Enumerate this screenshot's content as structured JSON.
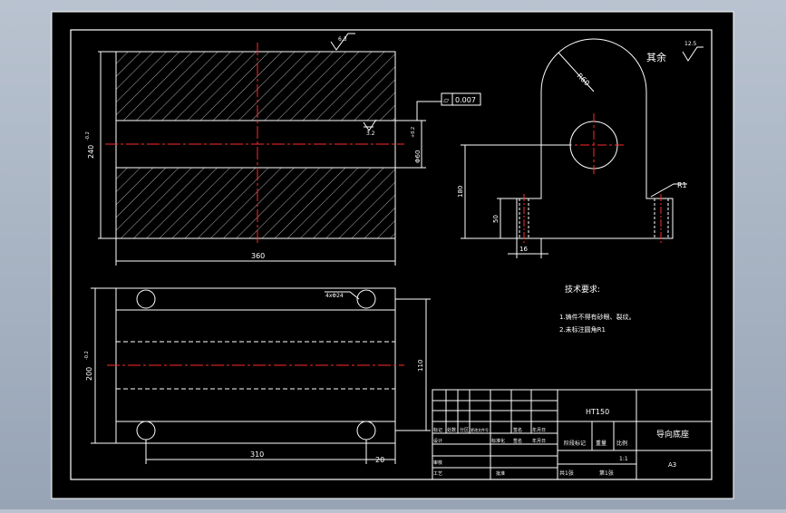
{
  "drawing": {
    "surface_roughness_label": "其余",
    "surface_roughness_value": "12.5",
    "roughness_top": "6.3",
    "roughness_bore": "3.2",
    "dims": {
      "height_240": "240",
      "tol_240": "-0.2",
      "bore_dia": "Φ60",
      "bore_tol": "+0.2",
      "width_360": "360",
      "radius_r60": "R60",
      "height_180": "180",
      "slot_depth_50": "50",
      "slot_width_16": "16",
      "fillet_r1": "R1",
      "hole_4x24": "4xΦ24",
      "width_200": "200",
      "tol_200": "-0.2",
      "dist_110": "110",
      "dist_310": "310",
      "dist_20": "20",
      "flatness_symbol": "▱",
      "flatness_value": "0.007"
    },
    "notes": {
      "title": "技术要求:",
      "items": [
        "1.铸件不得有砂眼、裂纹。",
        "2.未标注圆角R1"
      ]
    }
  },
  "title_block": {
    "material": "HT150",
    "part_name": "导向底座",
    "drawing_no": "A3",
    "scale_label": "比例",
    "scale_value": "1:1",
    "weight_label": "重量",
    "stage_label": "阶段标记",
    "sheet_info": "第1张",
    "total_sheets": "共1张",
    "row_headers": [
      "标记",
      "处数",
      "分区",
      "更改文件号",
      "签名",
      "年月日"
    ],
    "design_row": [
      "设计",
      "",
      "",
      "标准化",
      "签名",
      "年月日"
    ],
    "review_label": "审核",
    "process_label": "工艺",
    "approve_label": "批准"
  }
}
